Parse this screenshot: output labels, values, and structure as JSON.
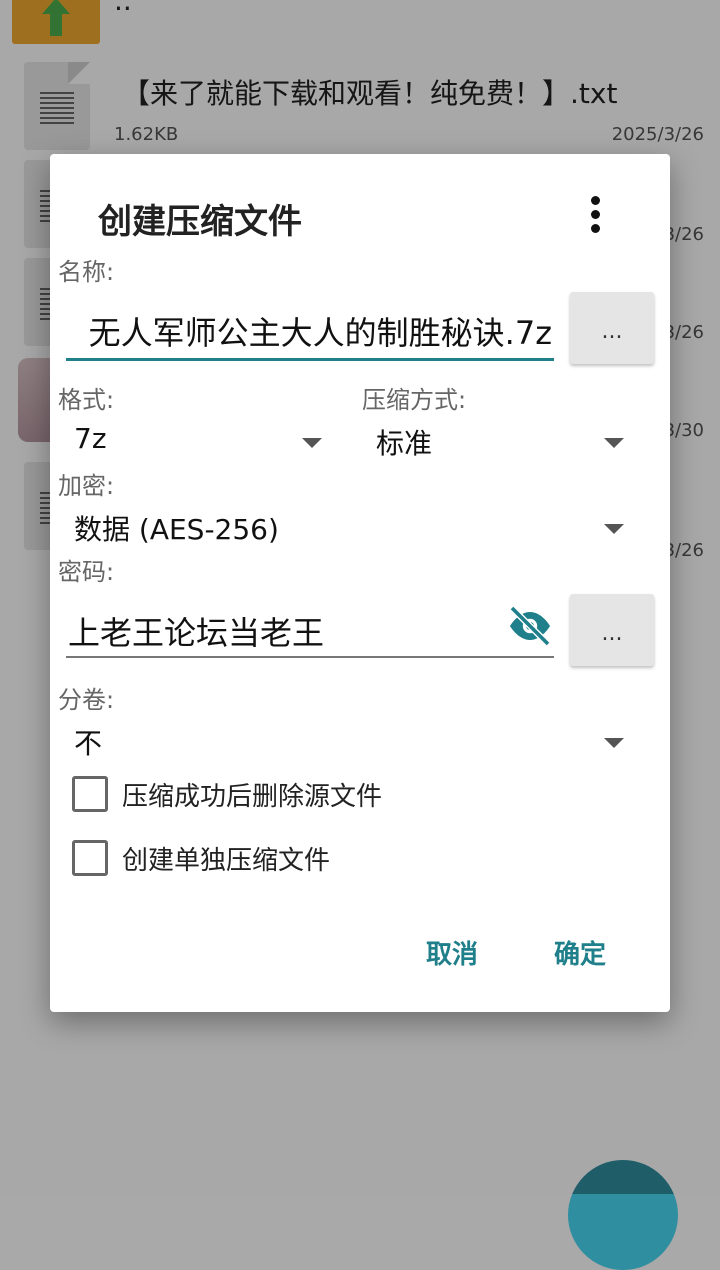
{
  "background": {
    "up_folder_label": "..",
    "files": [
      {
        "name": "【来了就能下载和观看！纯免费！】.txt",
        "size": "1.62KB",
        "date": "2025/3/26"
      }
    ],
    "partial_dates": [
      "3/26",
      "3/26",
      "3/30",
      "3/26"
    ]
  },
  "dialog": {
    "title": "创建压缩文件",
    "name_label": "名称:",
    "name_value": "无人军师公主大人的制胜秘诀.7z",
    "browse_label": "...",
    "format_label": "格式:",
    "format_value": "7z",
    "method_label": "压缩方式:",
    "method_value": "标准",
    "encrypt_label": "加密:",
    "encrypt_value": "数据 (AES-256)",
    "password_label": "密码:",
    "password_value": "上老王论坛当老王",
    "password_more_label": "...",
    "split_label": "分卷:",
    "split_value": "不",
    "delete_source_label": "压缩成功后删除源文件",
    "separate_archives_label": "创建单独压缩文件",
    "cancel_label": "取消",
    "ok_label": "确定"
  },
  "colors": {
    "accent": "#1f7f8a",
    "fab": "#2f8ea0"
  },
  "icons": [
    "more-vert-icon",
    "visibility-off-icon",
    "chevron-down-icon",
    "text-file-icon",
    "up-folder-icon"
  ]
}
